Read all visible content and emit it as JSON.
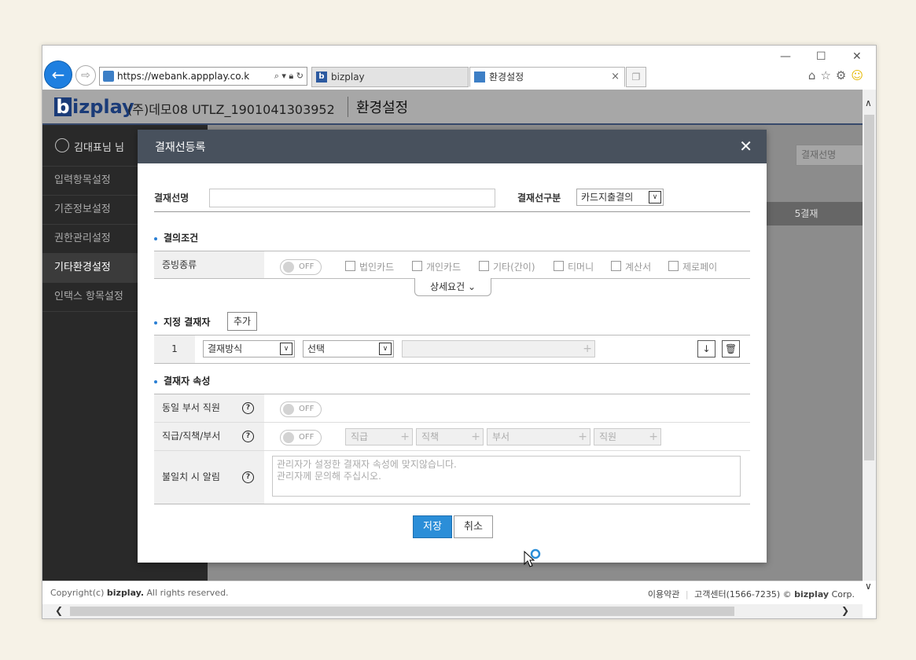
{
  "browser": {
    "url": "https://webank.appplay.co.kr/er",
    "tabs": [
      {
        "label": "bizplay"
      },
      {
        "label": "환경설정"
      }
    ],
    "tab_close": "×",
    "win_controls": {
      "minimize": "—",
      "maximize": "☐",
      "close": "✕"
    }
  },
  "header": {
    "logo_b": "b",
    "logo_rest": "izplay",
    "company": "(주)데모08 UTLZ_1901041303952",
    "title": "환경설정"
  },
  "sidebar": {
    "user": "김대표님 님",
    "items": [
      {
        "label": "입력항목설정"
      },
      {
        "label": "기준정보설정"
      },
      {
        "label": "권한관리설정"
      },
      {
        "label": "기타환경설정"
      },
      {
        "label": "인택스 항목설정"
      }
    ]
  },
  "content": {
    "search_placeholder": "결재선명",
    "column_label": "5결재"
  },
  "modal": {
    "title": "결재선등록",
    "close": "✕",
    "line_name_label": "결재선명",
    "line_name_value": "",
    "line_type_label": "결재선구분",
    "line_type_value": "카드지출결의",
    "conditions": {
      "title": "결의조건",
      "evidence_label": "증빙종류",
      "toggle_state": "OFF",
      "checkboxes": [
        {
          "label": "법인카드"
        },
        {
          "label": "개인카드"
        },
        {
          "label": "기타(간이)"
        },
        {
          "label": "티머니"
        },
        {
          "label": "계산서"
        },
        {
          "label": "제로페이"
        }
      ],
      "detail_button": "상세요건"
    },
    "approvers": {
      "title": "지정 결재자",
      "add_button": "추가",
      "row_number": "1",
      "method_value": "결재방식",
      "select_value": "선택",
      "plus": "+"
    },
    "attributes": {
      "title": "결재자 속성",
      "same_dept_label": "동일 부서 직원",
      "position_label": "직급/직책/부서",
      "mismatch_label": "불일치 시 알림",
      "help": "?",
      "fields": [
        {
          "placeholder": "직급"
        },
        {
          "placeholder": "직책"
        },
        {
          "placeholder": "부서"
        },
        {
          "placeholder": "직원"
        }
      ],
      "message_line1": "관리자가 설정한 결재자 속성에 맞지않습니다.",
      "message_line2": "관리자께 문의해 주십시오."
    },
    "save_button": "저장",
    "cancel_button": "취소"
  },
  "footer": {
    "copyright_prefix": "Copyright(c)",
    "copyright_brand": "bizplay.",
    "copyright_suffix": "All rights reserved.",
    "terms": "이용약관",
    "support": "고객센터(1566-7235)",
    "corp_prefix": "©",
    "corp_brand": "bizplay",
    "corp_suffix": "Corp."
  },
  "colors": {
    "primary": "#2b8ed8",
    "modal_header": "#48515d",
    "brand": "#1a3b78",
    "sidebar": "#292929"
  }
}
